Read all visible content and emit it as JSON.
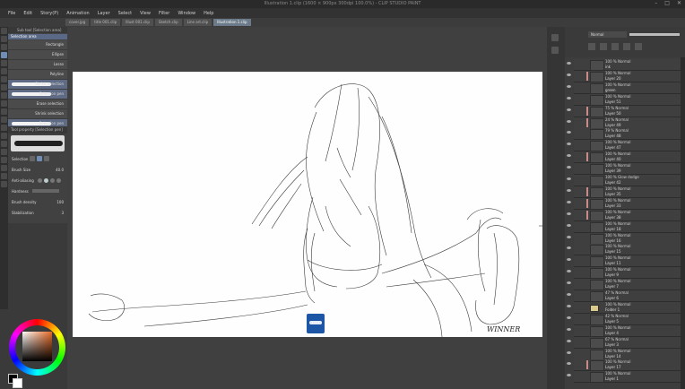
{
  "window": {
    "title": "Illustration 1.clip (1600 × 900px 300dpi 100.0%)   - CLIP STUDIO PAINT",
    "controls": [
      "–",
      "□",
      "✕"
    ]
  },
  "menu": [
    "File",
    "Edit",
    "Story(P)",
    "Animation",
    "Layer",
    "Select",
    "View",
    "Filter",
    "Window",
    "Help"
  ],
  "tabs": [
    {
      "label": "cover.jpg"
    },
    {
      "label": "title 001.clip"
    },
    {
      "label": "Illust 001.clip"
    },
    {
      "label": "Sketch.clip"
    },
    {
      "label": "Line art.clip"
    },
    {
      "label": "Illustration 1.clip",
      "active": true
    }
  ],
  "subtool": {
    "header": "Sub tool [Selection area]",
    "group": "Selection area",
    "items": [
      "Rectangle",
      "Ellipse",
      "Lasso",
      "Polyline",
      "Shrink selection",
      "Selection pen",
      "Erase selection",
      "Shrink selection",
      "Selection pen"
    ]
  },
  "toolprop": {
    "header": "Tool property [Selection pen]",
    "rows": [
      {
        "label": "Selection"
      },
      {
        "label": "Brush Size",
        "value": "40.0"
      },
      {
        "label": "Anti-aliasing"
      },
      {
        "label": "Hardness"
      },
      {
        "label": "Brush density",
        "value": "100"
      },
      {
        "label": "Stabilization",
        "value": "3"
      }
    ]
  },
  "layers": {
    "blend": "Normal",
    "rows": [
      {
        "mode": "100 % Normal",
        "name": "ink"
      },
      {
        "mode": "100 % Normal",
        "name": "Layer 20",
        "mark": true
      },
      {
        "mode": "100 % Normal",
        "name": "green"
      },
      {
        "mode": "100 % Normal",
        "name": "Layer 51"
      },
      {
        "mode": "75 % Normal",
        "name": "Layer 50",
        "mark": true
      },
      {
        "mode": "24 % Normal",
        "name": "Layer 49",
        "mark": true
      },
      {
        "mode": "79 % Normal",
        "name": "Layer 48"
      },
      {
        "mode": "100 % Normal",
        "name": "Layer 47"
      },
      {
        "mode": "100 % Normal",
        "name": "Layer 40",
        "mark": true
      },
      {
        "mode": "100 % Normal",
        "name": "Layer 39"
      },
      {
        "mode": "100 % Glow dodge",
        "name": "Layer 42"
      },
      {
        "mode": "100 % Normal",
        "name": "Layer 35",
        "mark": true
      },
      {
        "mode": "100 % Normal",
        "name": "Layer 33",
        "mark": true
      },
      {
        "mode": "100 % Normal",
        "name": "Layer 38",
        "mark": true
      },
      {
        "mode": "100 % Normal",
        "name": "Layer 18"
      },
      {
        "mode": "100 % Normal",
        "name": "Layer 16"
      },
      {
        "mode": "100 % Normal",
        "name": "Layer 15"
      },
      {
        "mode": "100 % Normal",
        "name": "Layer 11"
      },
      {
        "mode": "100 % Normal",
        "name": "Layer 9"
      },
      {
        "mode": "100 % Normal",
        "name": "Layer 7"
      },
      {
        "mode": "47 % Normal",
        "name": "Layer 6"
      },
      {
        "mode": "100 % Normal",
        "name": "Folder 1",
        "folder": true
      },
      {
        "mode": "42 % Normal",
        "name": "Layer 5"
      },
      {
        "mode": "100 % Normal",
        "name": "Layer 4"
      },
      {
        "mode": "67 % Normal",
        "name": "Layer 3"
      },
      {
        "mode": "100 % Normal",
        "name": "Layer 14"
      },
      {
        "mode": "100 % Normal",
        "name": "Layer 17",
        "mark": true
      },
      {
        "mode": "100 % Normal",
        "name": "Layer 1"
      }
    ]
  },
  "canvas": {
    "signature": "WINNER"
  },
  "colors": {
    "accent": "#5a6a86",
    "paper": "#fefefe",
    "line": "#3a3a3a"
  }
}
